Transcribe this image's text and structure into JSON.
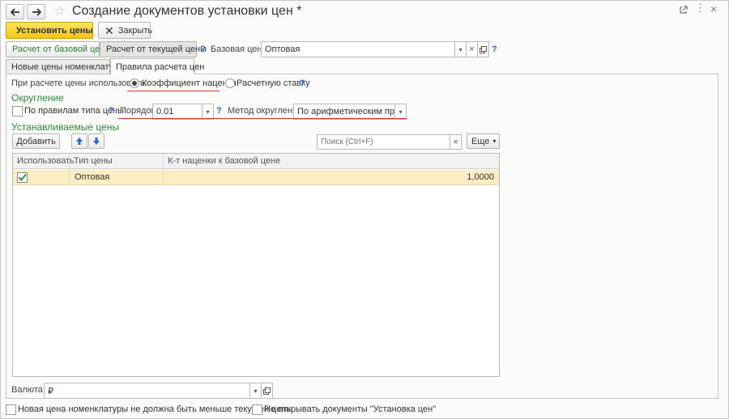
{
  "window": {
    "title": "Создание документов установки цен *",
    "icons": [
      "arrow-left-icon",
      "arrow-right-icon",
      "star-icon",
      "link-icon",
      "more-icon",
      "close-icon"
    ]
  },
  "toolbar": {
    "set_prices_label": "Установить цены",
    "close_label": "Закрыть"
  },
  "calc": {
    "from_base_label": "Расчет от базовой цены",
    "from_current_label": "Расчет от текущей цены",
    "help": "?",
    "base_price_label": "Базовая цена:",
    "base_price_value": "Оптовая",
    "base_help": "?"
  },
  "tabs": [
    {
      "label": "Новые цены номенклатуры"
    },
    {
      "label": "Правила расчета цен"
    }
  ],
  "rules": {
    "use_label": "При расчете цены использовать:",
    "option_markup": "Коэффициент наценки",
    "option_rate": "Расчетную ставку",
    "help": "?"
  },
  "rounding": {
    "heading": "Округление",
    "by_type_label": "По правилам типа цены",
    "by_type_help": "?",
    "order_label": "Порядок:",
    "order_value": "0.01",
    "order_help": "?",
    "method_label": "Метод округления:",
    "method_value": "По арифметическим правилам"
  },
  "prices": {
    "heading": "Устанавливаемые цены",
    "add_label": "Добавить",
    "search_placeholder": "Поиск (Ctrl+F)",
    "search_clear": "×",
    "more_label": "Еще",
    "columns": [
      "Использовать",
      "Тип цены",
      "К-т наценки к базовой цене"
    ],
    "rows": [
      {
        "use": true,
        "type": "Оптовая",
        "coef": "1,0000"
      }
    ]
  },
  "currency": {
    "label": "Валюта:",
    "value": "₽"
  },
  "footer": {
    "not_less_label": "Новая цена номенклатуры не должна быть меньше текущей цены",
    "not_open_label": "Не открывать документы \"Установка цен\""
  },
  "colors": {
    "accent": "#f3c613",
    "green": "#2f8d3b",
    "help_blue": "#2b66c9",
    "selection": "#fbeec4",
    "underline_red": "#e03030"
  }
}
